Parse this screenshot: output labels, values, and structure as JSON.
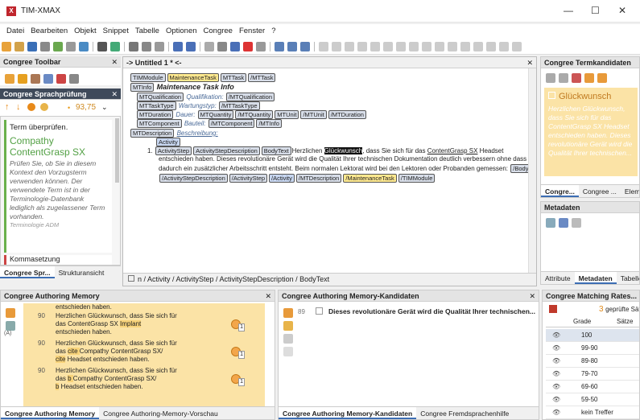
{
  "window": {
    "title": "TIM-XMAX",
    "minimize": "—",
    "maximize": "☐",
    "close": "✕"
  },
  "menu": [
    "Datei",
    "Bearbeiten",
    "Objekt",
    "Snippet",
    "Tabelle",
    "Optionen",
    "Congree",
    "Fenster",
    "?"
  ],
  "toolbar_panel": {
    "title": "Congree Toolbar"
  },
  "sprach": {
    "title": "Congree Sprachprüfung",
    "score": "93,75",
    "heading": "Term überprüfen.",
    "term": "Compathy ContentGrasp SX",
    "desc": "Prüfen Sie, ob Sie in diesem Kontext den Vorzugsterm verwenden können. Der verwendete Term ist in der Terminologie-Datenbank lediglich als zugelassener Term vorhanden.",
    "source": "Terminologie ADM",
    "next": "Kommasetzung",
    "tabs": [
      "Congree Spr...",
      "Strukturansicht"
    ]
  },
  "editor": {
    "tab": "-> Untitled 1 *",
    "tab_close": "<-",
    "path": "n / Activity / ActivityStep / ActivityStepDescription / BodyText",
    "tags": {
      "TIMModule": "TIMModule",
      "MaintenanceTask": "MaintenanceTask",
      "MTTask": "MTTask",
      "MTTask_end": "/MTTask",
      "MTInfo": "MTInfo",
      "MTQualification": "MTQualification",
      "MTQualification_end": "/MTQualification",
      "MTTaskType": "MTTaskType",
      "MTTaskType_end": "/MTTaskType",
      "MTDuration": "MTDuration",
      "MTQuantity": "MTQuantity",
      "MTQuantity_end": "/MTQuantity",
      "MTUnit": "MTUnit",
      "MTUnit_end": "/MTUnit",
      "MTDuration_end": "/MTDuration",
      "MTComponent": "MTComponent",
      "MTComponent_end": "/MTComponent",
      "MTInfo_end": "/MTInfo",
      "MTDescription": "MTDescription",
      "Activity": "Activity",
      "ActivityStep": "ActivityStep",
      "ActivityStepDescription": "ActivityStepDescription",
      "BodyText": "BodyText",
      "BodyText_end": "/BodyText",
      "ActivityStepDescription_end": "/ActivityStepDescription",
      "ActivityStep_end": "/ActivityStep",
      "Activity_end": "/Activity",
      "MTDescription_end": "/MTDescription",
      "MaintenanceTask_end": "/MaintenanceTask",
      "TIMModule_end": "/TIMModule"
    },
    "heading": "Maintenance Task Info",
    "qual": "Qualifikation:",
    "wart": "Wartungstyp:",
    "dauer": "Dauer:",
    "bauteil": "Bauteil:",
    "beschreibung": "Beschreibung:",
    "num": "1.",
    "text_pre": "Herzlichen ",
    "text_hl": "Glückwunsch",
    "text_mid": ", dass Sie sich für das ",
    "text_link": "ContentGrasp SX",
    "text_post": " Headset",
    "line2": "entschieden haben. Dieses revolutionäre Gerät wird die Qualität Ihrer technischen Dokumentation deutlich verbessern ohne dass",
    "line3": "dadurch ein zusätzlicher Arbeitsschritt entsteht. Beim normalen Lektorat wird bei den Lektoren oder Probanden gemessen:"
  },
  "termkand": {
    "title": "Congree Termkandidaten",
    "term": "Glückwunsch",
    "text": "Herzlichen Glückwunsch, dass Sie sich für das ContentGrasp SX Headset entschieden haben. Dieses revolutionäre Gerät wird die Qualität Ihrer technischen...",
    "tabs": [
      "Congre...",
      "Congree ...",
      "Elemente"
    ]
  },
  "metadaten": {
    "title": "Metadaten",
    "tabs": [
      "Attribute",
      "Metadaten",
      "Tabelle"
    ]
  },
  "tm": {
    "title": "Congree Authoring Memory",
    "top": "entschieden haben.",
    "rows": [
      {
        "num": "90",
        "a": "Herzlichen Glückwunsch, dass Sie sich für",
        "b_pre": "das ContentGrasp SX ",
        "b_mark": "Implant",
        "c": "entschieden haben.",
        "badge": "1"
      },
      {
        "num": "90",
        "a": "Herzlichen Glückwunsch, dass Sie sich für",
        "b_pre": "das ",
        "b_mark": " cite ",
        "b_post": "Compathy ContentGrasp SX/",
        "c_mark": "cite",
        "c_post": " Headset entschieden haben.",
        "badge": "1"
      },
      {
        "num": "90",
        "a": "Herzlichen Glückwunsch, dass Sie sich für",
        "b_pre": "das ",
        "b_mark": "b ",
        "b_post": "Compathy ContentGrasp SX/",
        "c_mark": "b",
        "c_post": " Headset entschieden haben.",
        "badge": "1"
      }
    ],
    "tabs": [
      "Congree Authoring Memory",
      "Congree Authoring-Memory-Vorschau"
    ]
  },
  "amk": {
    "title": "Congree Authoring Memory-Kandidaten",
    "num": "89",
    "text": "Dieses revolutionäre Gerät wird die Qualität Ihrer technischen...",
    "tabs": [
      "Congree Authoring Memory-Kandidaten",
      "Congree Fremdsprachenhilfe"
    ]
  },
  "match": {
    "title": "Congree Matching Rates...",
    "count": "3",
    "count_label": "geprüfte Sät",
    "col1": "Grade",
    "col2": "Sätze",
    "rows": [
      "100",
      "99-90",
      "89-80",
      "79-70",
      "69-60",
      "59-50",
      "kein Treffer"
    ]
  }
}
